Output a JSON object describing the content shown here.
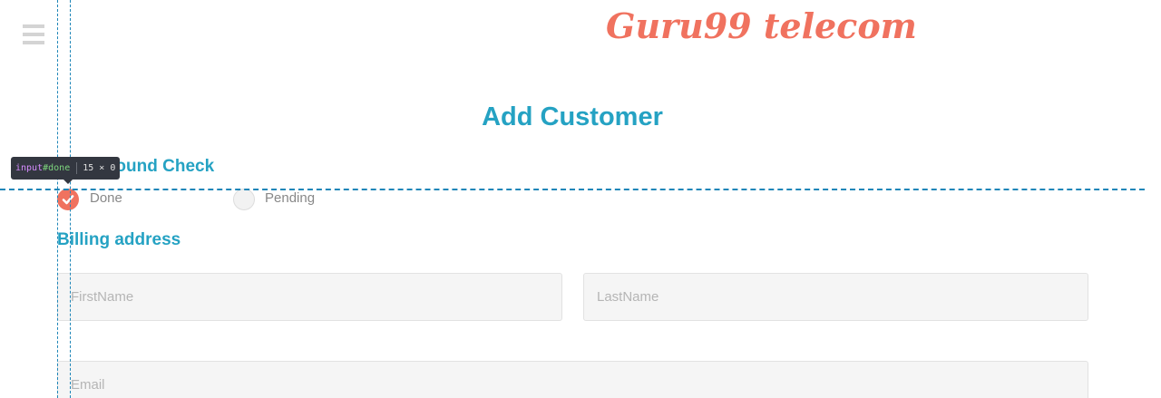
{
  "header": {
    "brand": "Guru99 telecom",
    "menu_icon": "hamburger-menu-icon"
  },
  "main": {
    "title": "Add Customer",
    "background_check": {
      "title": "Background Check",
      "options": [
        {
          "label": "Done",
          "checked": true,
          "icon": "check-icon"
        },
        {
          "label": "Pending",
          "checked": false
        }
      ]
    },
    "billing": {
      "title": "Billing address",
      "first_name_placeholder": "FirstName",
      "last_name_placeholder": "LastName",
      "email_placeholder": "Email"
    }
  },
  "devtools": {
    "tag": "input",
    "id": "#done",
    "size": "15 × 0"
  },
  "colors": {
    "accent": "#25a2c3",
    "brand": "#f0725f",
    "guide": "#1f86b8"
  }
}
